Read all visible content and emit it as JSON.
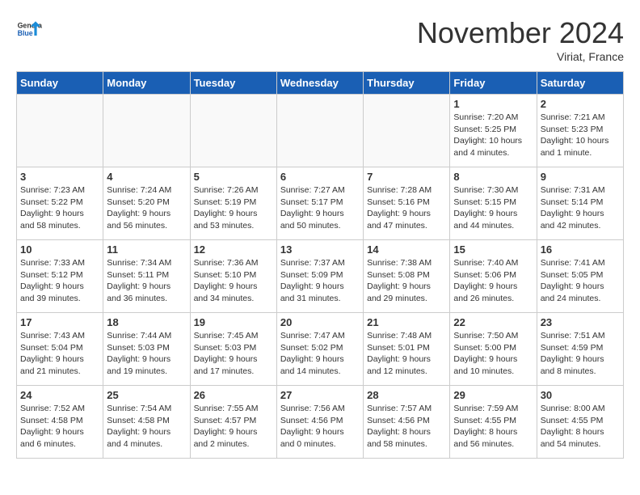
{
  "header": {
    "logo_line1": "General",
    "logo_line2": "Blue",
    "month": "November 2024",
    "location": "Viriat, France"
  },
  "weekdays": [
    "Sunday",
    "Monday",
    "Tuesday",
    "Wednesday",
    "Thursday",
    "Friday",
    "Saturday"
  ],
  "weeks": [
    [
      {
        "day": "",
        "info": ""
      },
      {
        "day": "",
        "info": ""
      },
      {
        "day": "",
        "info": ""
      },
      {
        "day": "",
        "info": ""
      },
      {
        "day": "",
        "info": ""
      },
      {
        "day": "1",
        "info": "Sunrise: 7:20 AM\nSunset: 5:25 PM\nDaylight: 10 hours\nand 4 minutes."
      },
      {
        "day": "2",
        "info": "Sunrise: 7:21 AM\nSunset: 5:23 PM\nDaylight: 10 hours\nand 1 minute."
      }
    ],
    [
      {
        "day": "3",
        "info": "Sunrise: 7:23 AM\nSunset: 5:22 PM\nDaylight: 9 hours\nand 58 minutes."
      },
      {
        "day": "4",
        "info": "Sunrise: 7:24 AM\nSunset: 5:20 PM\nDaylight: 9 hours\nand 56 minutes."
      },
      {
        "day": "5",
        "info": "Sunrise: 7:26 AM\nSunset: 5:19 PM\nDaylight: 9 hours\nand 53 minutes."
      },
      {
        "day": "6",
        "info": "Sunrise: 7:27 AM\nSunset: 5:17 PM\nDaylight: 9 hours\nand 50 minutes."
      },
      {
        "day": "7",
        "info": "Sunrise: 7:28 AM\nSunset: 5:16 PM\nDaylight: 9 hours\nand 47 minutes."
      },
      {
        "day": "8",
        "info": "Sunrise: 7:30 AM\nSunset: 5:15 PM\nDaylight: 9 hours\nand 44 minutes."
      },
      {
        "day": "9",
        "info": "Sunrise: 7:31 AM\nSunset: 5:14 PM\nDaylight: 9 hours\nand 42 minutes."
      }
    ],
    [
      {
        "day": "10",
        "info": "Sunrise: 7:33 AM\nSunset: 5:12 PM\nDaylight: 9 hours\nand 39 minutes."
      },
      {
        "day": "11",
        "info": "Sunrise: 7:34 AM\nSunset: 5:11 PM\nDaylight: 9 hours\nand 36 minutes."
      },
      {
        "day": "12",
        "info": "Sunrise: 7:36 AM\nSunset: 5:10 PM\nDaylight: 9 hours\nand 34 minutes."
      },
      {
        "day": "13",
        "info": "Sunrise: 7:37 AM\nSunset: 5:09 PM\nDaylight: 9 hours\nand 31 minutes."
      },
      {
        "day": "14",
        "info": "Sunrise: 7:38 AM\nSunset: 5:08 PM\nDaylight: 9 hours\nand 29 minutes."
      },
      {
        "day": "15",
        "info": "Sunrise: 7:40 AM\nSunset: 5:06 PM\nDaylight: 9 hours\nand 26 minutes."
      },
      {
        "day": "16",
        "info": "Sunrise: 7:41 AM\nSunset: 5:05 PM\nDaylight: 9 hours\nand 24 minutes."
      }
    ],
    [
      {
        "day": "17",
        "info": "Sunrise: 7:43 AM\nSunset: 5:04 PM\nDaylight: 9 hours\nand 21 minutes."
      },
      {
        "day": "18",
        "info": "Sunrise: 7:44 AM\nSunset: 5:03 PM\nDaylight: 9 hours\nand 19 minutes."
      },
      {
        "day": "19",
        "info": "Sunrise: 7:45 AM\nSunset: 5:03 PM\nDaylight: 9 hours\nand 17 minutes."
      },
      {
        "day": "20",
        "info": "Sunrise: 7:47 AM\nSunset: 5:02 PM\nDaylight: 9 hours\nand 14 minutes."
      },
      {
        "day": "21",
        "info": "Sunrise: 7:48 AM\nSunset: 5:01 PM\nDaylight: 9 hours\nand 12 minutes."
      },
      {
        "day": "22",
        "info": "Sunrise: 7:50 AM\nSunset: 5:00 PM\nDaylight: 9 hours\nand 10 minutes."
      },
      {
        "day": "23",
        "info": "Sunrise: 7:51 AM\nSunset: 4:59 PM\nDaylight: 9 hours\nand 8 minutes."
      }
    ],
    [
      {
        "day": "24",
        "info": "Sunrise: 7:52 AM\nSunset: 4:58 PM\nDaylight: 9 hours\nand 6 minutes."
      },
      {
        "day": "25",
        "info": "Sunrise: 7:54 AM\nSunset: 4:58 PM\nDaylight: 9 hours\nand 4 minutes."
      },
      {
        "day": "26",
        "info": "Sunrise: 7:55 AM\nSunset: 4:57 PM\nDaylight: 9 hours\nand 2 minutes."
      },
      {
        "day": "27",
        "info": "Sunrise: 7:56 AM\nSunset: 4:56 PM\nDaylight: 9 hours\nand 0 minutes."
      },
      {
        "day": "28",
        "info": "Sunrise: 7:57 AM\nSunset: 4:56 PM\nDaylight: 8 hours\nand 58 minutes."
      },
      {
        "day": "29",
        "info": "Sunrise: 7:59 AM\nSunset: 4:55 PM\nDaylight: 8 hours\nand 56 minutes."
      },
      {
        "day": "30",
        "info": "Sunrise: 8:00 AM\nSunset: 4:55 PM\nDaylight: 8 hours\nand 54 minutes."
      }
    ]
  ]
}
